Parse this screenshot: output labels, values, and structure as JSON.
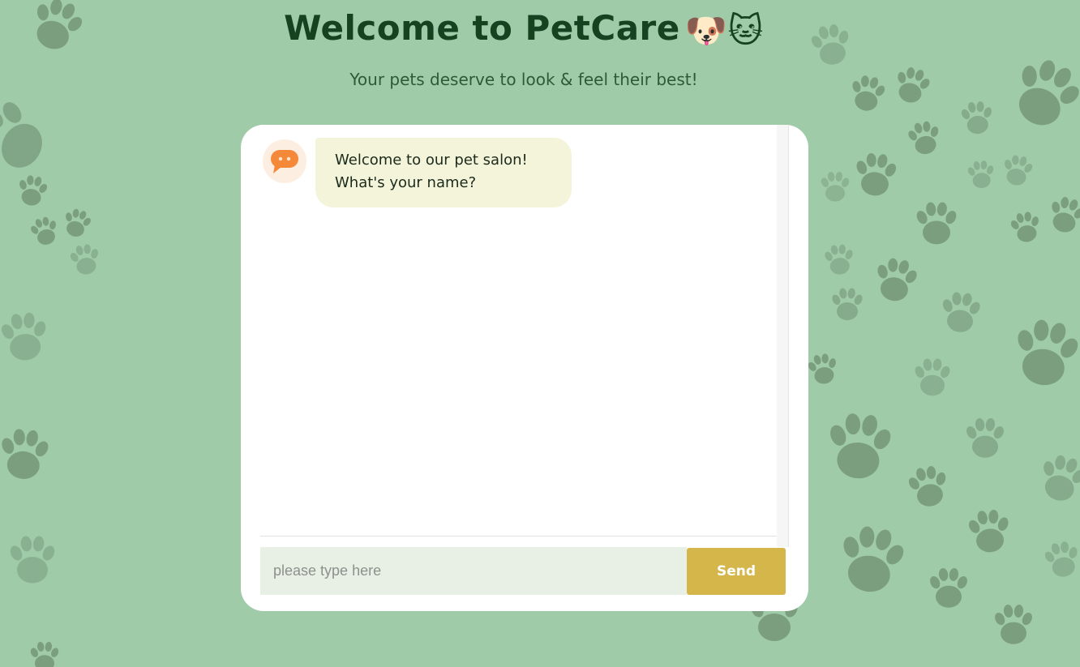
{
  "header": {
    "title": "Welcome to PetCare",
    "title_emoji": "🐶🐱",
    "subtitle": "Your pets deserve to look & feel their best!"
  },
  "chat": {
    "bot_avatar_icon": "chat-bubble-icon",
    "messages": [
      {
        "sender": "bot",
        "lines": [
          "Welcome to our pet salon!",
          "What's your name?"
        ]
      }
    ]
  },
  "composer": {
    "placeholder": "please type here",
    "value": "",
    "send_label": "Send"
  },
  "colors": {
    "background": "#9fcba8",
    "paw": "#6f8f72",
    "title": "#174222",
    "bubble": "#f3f4da",
    "send_button": "#d4b64b",
    "input_bg": "#e8efe5",
    "avatar_accent": "#f5893a"
  }
}
